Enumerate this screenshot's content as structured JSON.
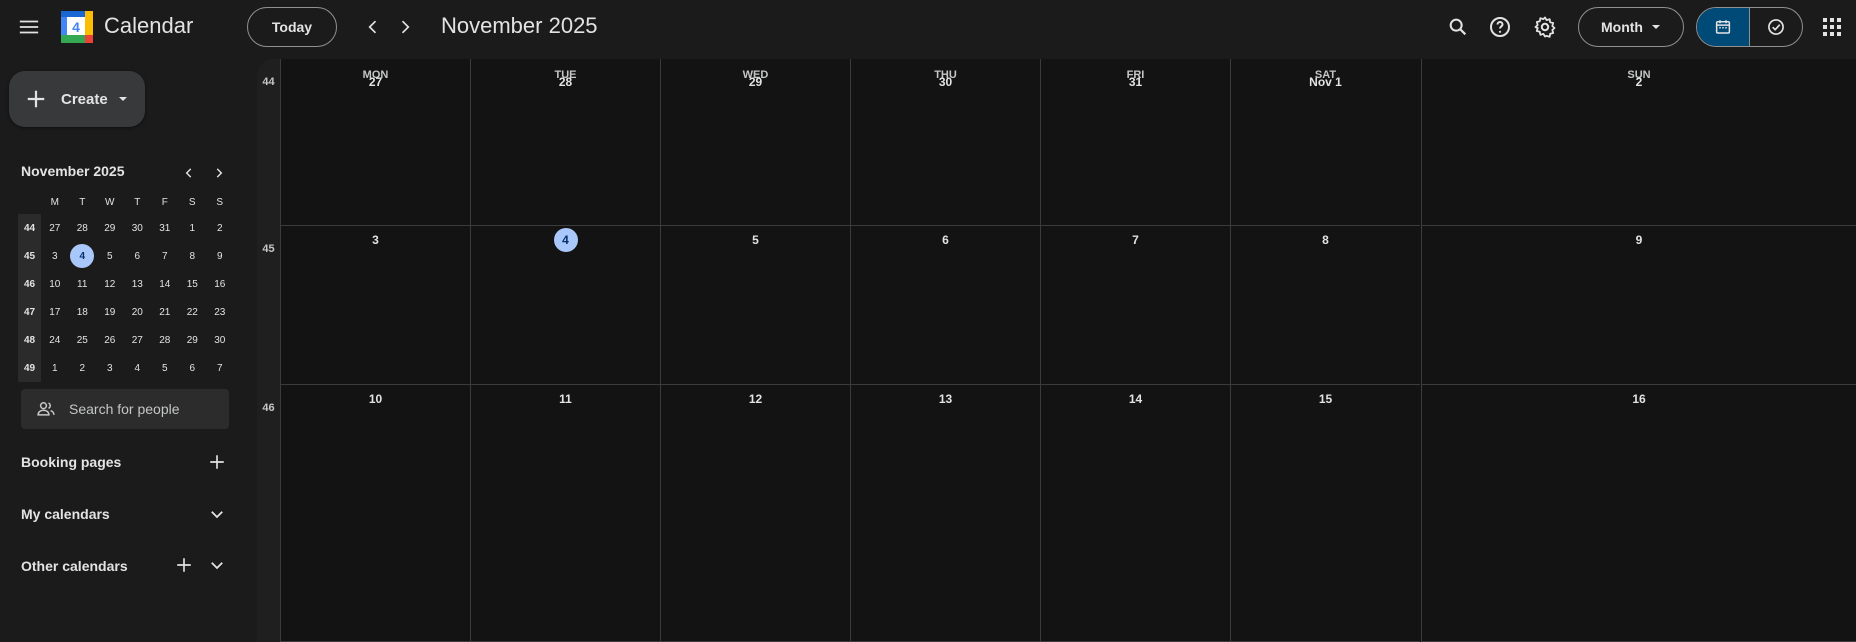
{
  "header": {
    "app_title": "Calendar",
    "logo_number": "4",
    "today_label": "Today",
    "period_title": "November 2025",
    "view_label": "Month"
  },
  "sidebar": {
    "create_label": "Create",
    "mini_calendar": {
      "title": "November 2025",
      "weekday_headers": [
        "M",
        "T",
        "W",
        "T",
        "F",
        "S",
        "S"
      ],
      "weeks": [
        {
          "week": "44",
          "days": [
            "27",
            "28",
            "29",
            "30",
            "31",
            "1",
            "2"
          ]
        },
        {
          "week": "45",
          "days": [
            "3",
            "4",
            "5",
            "6",
            "7",
            "8",
            "9"
          ]
        },
        {
          "week": "46",
          "days": [
            "10",
            "11",
            "12",
            "13",
            "14",
            "15",
            "16"
          ]
        },
        {
          "week": "47",
          "days": [
            "17",
            "18",
            "19",
            "20",
            "21",
            "22",
            "23"
          ]
        },
        {
          "week": "48",
          "days": [
            "24",
            "25",
            "26",
            "27",
            "28",
            "29",
            "30"
          ]
        },
        {
          "week": "49",
          "days": [
            "1",
            "2",
            "3",
            "4",
            "5",
            "6",
            "7"
          ]
        }
      ],
      "today": "4"
    },
    "search_placeholder": "Search for people",
    "booking_pages_label": "Booking pages",
    "my_calendars_label": "My calendars",
    "other_calendars_label": "Other calendars"
  },
  "month_view": {
    "weekday_headers": [
      "MON",
      "TUE",
      "WED",
      "THU",
      "FRI",
      "SAT",
      "SUN"
    ],
    "weeks": [
      {
        "week": "44",
        "days": [
          "27",
          "28",
          "29",
          "30",
          "31",
          "Nov 1",
          "2"
        ]
      },
      {
        "week": "45",
        "days": [
          "3",
          "4",
          "5",
          "6",
          "7",
          "8",
          "9"
        ]
      },
      {
        "week": "46",
        "days": [
          "10",
          "11",
          "12",
          "13",
          "14",
          "15",
          "16"
        ]
      }
    ],
    "today": "4"
  },
  "colors": {
    "accent": "#a8c7fa",
    "selected_mode": "#004a77",
    "background": "#1b1b1b",
    "grid_background": "#131313"
  }
}
